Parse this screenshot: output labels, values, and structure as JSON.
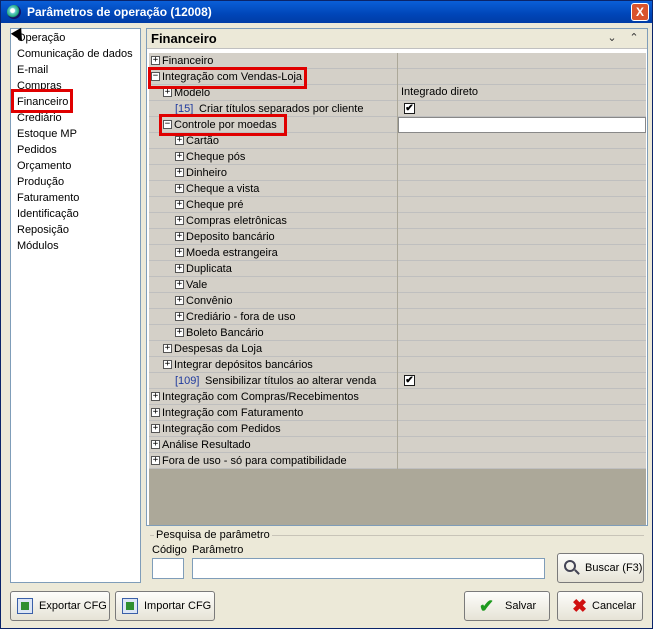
{
  "window": {
    "title": "Parâmetros de operação (12008)",
    "close_label": "X"
  },
  "sidebar": {
    "items": [
      "Operação",
      "Comunicação de dados",
      "E-mail",
      "Compras",
      "Financeiro",
      "Crediário",
      "Estoque MP",
      "Pedidos",
      "Orçamento",
      "Produção",
      "Faturamento",
      "Identificação",
      "Reposição",
      "Módulos"
    ]
  },
  "main": {
    "title": "Financeiro",
    "chev_down": "⌄",
    "chev_up": "⌃",
    "rows": [
      {
        "label": "Financeiro",
        "pm": "+",
        "value": ""
      },
      {
        "label": "Integração com Vendas-Loja",
        "pm": "−",
        "value": ""
      },
      {
        "label": "Modelo",
        "pm": "+",
        "value": "Integrado direto"
      },
      {
        "num": "[15]",
        "label": "Criar títulos separados por cliente",
        "checked": "✔"
      },
      {
        "label": "Controle por moedas",
        "pm": "−",
        "value": ""
      },
      {
        "label": "Cartão",
        "pm": "+"
      },
      {
        "label": "Cheque pós",
        "pm": "+"
      },
      {
        "label": "Dinheiro",
        "pm": "+"
      },
      {
        "label": "Cheque a vista",
        "pm": "+"
      },
      {
        "label": "Cheque pré",
        "pm": "+"
      },
      {
        "label": "Compras eletrônicas",
        "pm": "+"
      },
      {
        "label": "Deposito bancário",
        "pm": "+"
      },
      {
        "label": "Moeda estrangeira",
        "pm": "+"
      },
      {
        "label": "Duplicata",
        "pm": "+"
      },
      {
        "label": "Vale",
        "pm": "+"
      },
      {
        "label": "Convênio",
        "pm": "+"
      },
      {
        "label": "Crediário - fora de uso",
        "pm": "+"
      },
      {
        "label": "Boleto Bancário",
        "pm": "+"
      },
      {
        "label": "Despesas da Loja",
        "pm": "+"
      },
      {
        "label": "Integrar depósitos bancários",
        "pm": "+"
      },
      {
        "num": "[109]",
        "label": "Sensibilizar títulos ao alterar venda",
        "checked": "✔"
      },
      {
        "label": "Integração com Compras/Recebimentos",
        "pm": "+"
      },
      {
        "label": "Integração com Faturamento",
        "pm": "+"
      },
      {
        "label": "Integração com Pedidos",
        "pm": "+"
      },
      {
        "label": "Análise Resultado",
        "pm": "+"
      },
      {
        "label": "Fora de uso - só para compatibilidade",
        "pm": "+"
      }
    ]
  },
  "search": {
    "legend": "Pesquisa de parâmetro",
    "codigo_label": "Código",
    "parametro_label": "Parâmetro",
    "codigo_value": "",
    "parametro_value": "",
    "buscar_label": "Buscar (F3)"
  },
  "footer": {
    "exportar_label": "Exportar CFG",
    "importar_label": "Importar CFG",
    "salvar_label": "Salvar",
    "cancelar_label": "Cancelar"
  }
}
